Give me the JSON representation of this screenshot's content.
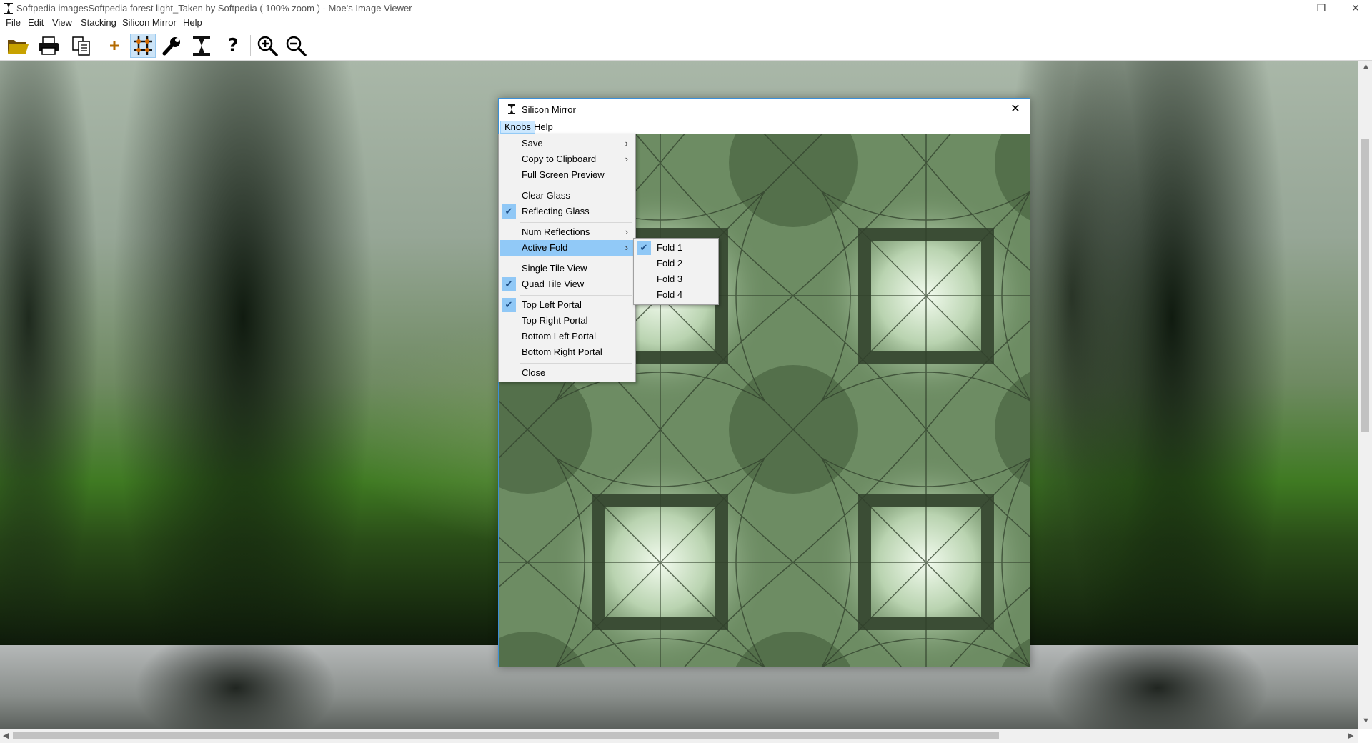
{
  "window": {
    "title": "Softpedia imagesSoftpedia forest light_Taken by Softpedia ( 100% zoom ) - Moe's Image Viewer",
    "minimize": "—",
    "restore": "❐",
    "close": "✕"
  },
  "menubar": [
    "File",
    "Edit",
    "View",
    "Stacking",
    "Silicon Mirror",
    "Help"
  ],
  "toolbar": {
    "buttons": [
      {
        "icon": "open-folder-icon"
      },
      {
        "icon": "print-icon"
      },
      {
        "icon": "copy-pages-icon"
      },
      {
        "icon": "plus-icon"
      },
      {
        "icon": "grid-tiles-icon",
        "active": true
      },
      {
        "icon": "wrench-icon"
      },
      {
        "icon": "silicon-mirror-icon"
      },
      {
        "icon": "help-icon",
        "glyph": "?"
      },
      {
        "icon": "zoom-in-icon"
      },
      {
        "icon": "zoom-out-icon"
      }
    ]
  },
  "dialog": {
    "title": "Silicon Mirror",
    "close": "✕",
    "menus": [
      "Knobs",
      "Help"
    ],
    "knobs_menu": [
      {
        "label": "Save",
        "submenu": true,
        "checked": false
      },
      {
        "label": "Copy to Clipboard",
        "submenu": true,
        "checked": false
      },
      {
        "label": "Full Screen Preview",
        "submenu": false,
        "checked": false
      },
      {
        "separator": true
      },
      {
        "label": "Clear Glass",
        "submenu": false,
        "checked": false
      },
      {
        "label": "Reflecting Glass",
        "submenu": false,
        "checked": true
      },
      {
        "separator": true
      },
      {
        "label": "Num Reflections",
        "submenu": true,
        "checked": false
      },
      {
        "label": "Active Fold",
        "submenu": true,
        "checked": false,
        "highlighted": true
      },
      {
        "separator": true
      },
      {
        "label": "Single Tile View",
        "submenu": false,
        "checked": false
      },
      {
        "label": "Quad Tile View",
        "submenu": false,
        "checked": true
      },
      {
        "separator": true
      },
      {
        "label": "Top Left Portal",
        "submenu": false,
        "checked": true
      },
      {
        "label": "Top Right Portal",
        "submenu": false,
        "checked": false
      },
      {
        "label": "Bottom Left Portal",
        "submenu": false,
        "checked": false
      },
      {
        "label": "Bottom Right Portal",
        "submenu": false,
        "checked": false
      },
      {
        "separator": true
      },
      {
        "label": "Close",
        "submenu": false,
        "checked": false
      }
    ],
    "fold_menu": [
      {
        "label": "Fold 1",
        "checked": true
      },
      {
        "label": "Fold 2",
        "checked": false
      },
      {
        "label": "Fold 3",
        "checked": false
      },
      {
        "label": "Fold 4",
        "checked": false
      }
    ]
  },
  "glyphs": {
    "check": "✔",
    "submenu_arrow": "›"
  },
  "colors": {
    "highlight": "#91c9f7",
    "check_bg": "#90c8f6",
    "dialog_border": "#3c8fd6"
  }
}
